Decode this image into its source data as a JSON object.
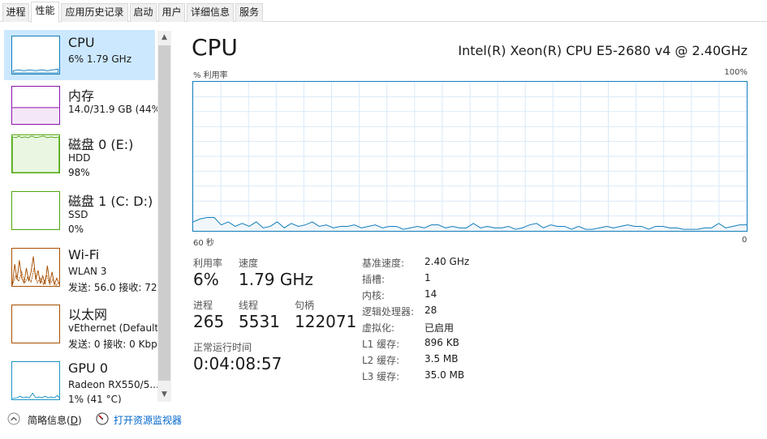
{
  "tabs": [
    "进程",
    "性能",
    "应用历史记录",
    "启动",
    "用户",
    "详细信息",
    "服务"
  ],
  "sidebar": {
    "items": [
      {
        "title": "CPU",
        "sub1": "6% 1.79 GHz",
        "sub2": ""
      },
      {
        "title": "内存",
        "sub1": "14.0/31.9 GB (44%)",
        "sub2": ""
      },
      {
        "title": "磁盘 0 (E:)",
        "sub1": "HDD",
        "sub2": "98%"
      },
      {
        "title": "磁盘 1 (C: D:)",
        "sub1": "SSD",
        "sub2": "0%"
      },
      {
        "title": "Wi-Fi",
        "sub1": "WLAN 3",
        "sub2": "发送: 56.0  接收: 72."
      },
      {
        "title": "以太网",
        "sub1": "vEthernet (Default ,",
        "sub2": "发送: 0 接收: 0 Kbp"
      },
      {
        "title": "GPU 0",
        "sub1": "Radeon RX550/5...",
        "sub2": "1% (41 °C)"
      }
    ]
  },
  "main": {
    "title": "CPU",
    "model": "Intel(R) Xeon(R) CPU E5-2680 v4 @ 2.40GHz",
    "graph": {
      "ylabel": "% 利用率",
      "ymax_label": "100%",
      "xleft_label": "60 秒",
      "xright_label": "0",
      "ylim": [
        0,
        100
      ],
      "values": [
        6,
        8,
        9,
        9,
        4,
        6,
        3,
        5,
        3,
        6,
        2,
        3,
        6,
        2,
        5,
        3,
        4,
        6,
        3,
        4,
        2,
        3,
        3,
        4,
        2,
        3,
        4,
        2,
        3,
        3,
        1,
        2,
        3,
        2,
        4,
        4,
        2,
        3,
        2,
        2,
        5,
        2,
        3,
        2,
        2,
        3,
        1,
        2,
        4,
        5,
        2,
        4,
        3,
        3,
        1,
        3,
        1,
        1,
        2,
        3,
        2,
        3,
        4,
        3,
        3,
        1,
        3,
        3,
        2,
        2,
        1,
        1,
        1,
        2,
        2,
        5,
        2,
        3,
        4,
        4
      ]
    },
    "stats": {
      "util_label": "利用率",
      "util_value": "6%",
      "speed_label": "速度",
      "speed_value": "1.79 GHz",
      "proc_label": "进程",
      "proc_value": "265",
      "thread_label": "线程",
      "thread_value": "5531",
      "handle_label": "句柄",
      "handle_value": "122071",
      "uptime_label": "正常运行时间",
      "uptime_value": "0:04:08:57"
    },
    "info": [
      {
        "label": "基准速度:",
        "value": "2.40 GHz"
      },
      {
        "label": "插槽:",
        "value": "1"
      },
      {
        "label": "内核:",
        "value": "14"
      },
      {
        "label": "逻辑处理器:",
        "value": "28"
      },
      {
        "label": "虚拟化:",
        "value": "已启用"
      },
      {
        "label": "L1 缓存:",
        "value": "896 KB"
      },
      {
        "label": "L2 缓存:",
        "value": "3.5 MB"
      },
      {
        "label": "L3 缓存:",
        "value": "35.0 MB"
      }
    ]
  },
  "footer": {
    "brief_prefix": "简略信息(",
    "brief_key": "D",
    "brief_suffix": ")",
    "monitor": "打开资源监视器"
  },
  "colors": {
    "cpu": "#117dbb",
    "memory": "#8b12ae",
    "disk": "#4da60c",
    "wifi": "#a74f01",
    "gpu": "#1b93c4",
    "selected": "#cce8ff",
    "link": "#0066cc"
  }
}
